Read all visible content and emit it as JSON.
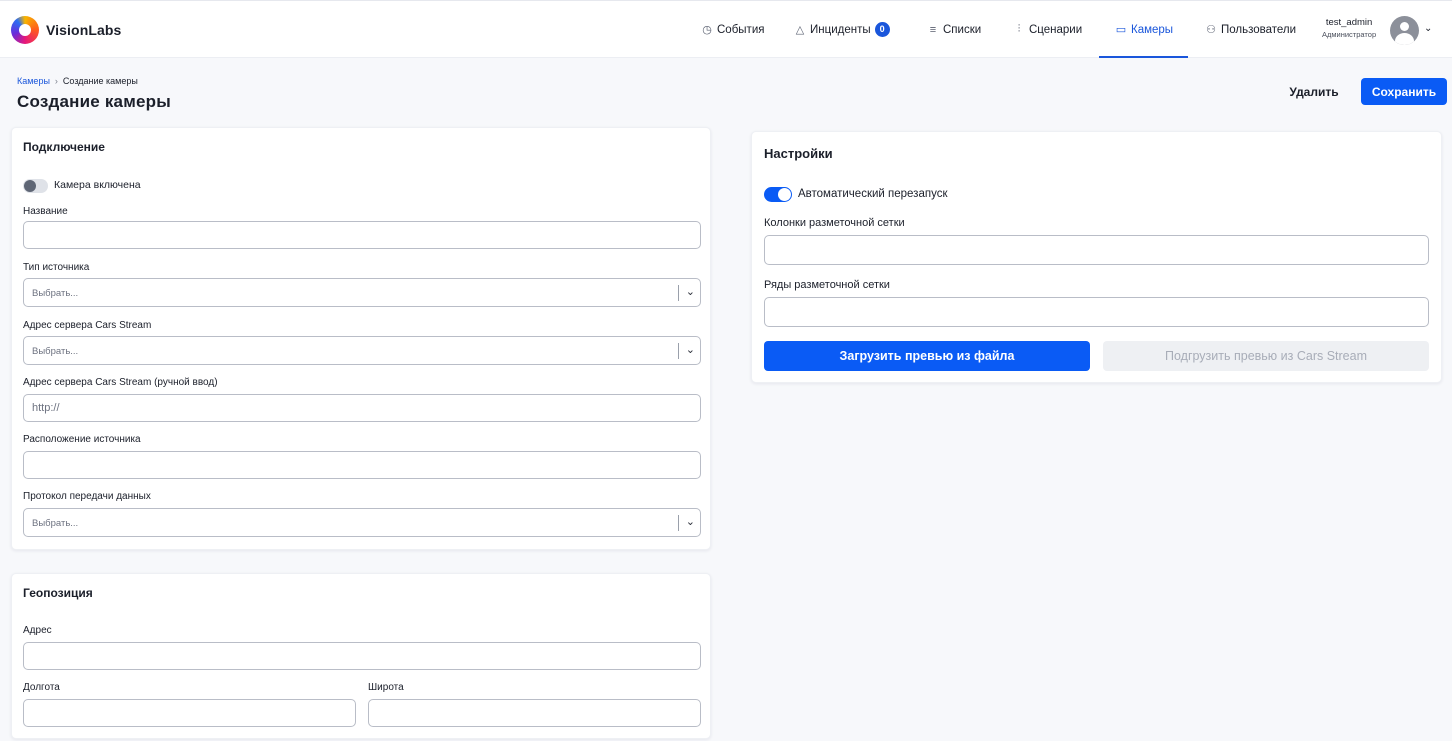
{
  "app": {
    "brand": "VisionLabs"
  },
  "nav": [
    {
      "label": "События",
      "icon": "clock-icon",
      "glyph": "◷"
    },
    {
      "label": "Инциденты",
      "icon": "warning-icon",
      "glyph": "△",
      "badge": "0"
    },
    {
      "label": "Списки",
      "icon": "list-icon",
      "glyph": "≡"
    },
    {
      "label": "Сценарии",
      "icon": "sliders-icon",
      "glyph": "⫶"
    },
    {
      "label": "Камеры",
      "icon": "camera-icon",
      "glyph": "▭",
      "active": true
    },
    {
      "label": "Пользователи",
      "icon": "users-icon",
      "glyph": "⚇"
    }
  ],
  "user": {
    "name": "test_admin",
    "role": "Администратор"
  },
  "breadcrumb": {
    "parent": "Камеры",
    "current": "Создание камеры"
  },
  "page": {
    "title": "Создание камеры"
  },
  "actions": {
    "delete": "Удалить",
    "save": "Сохранить"
  },
  "connection": {
    "title": "Подключение",
    "enabled_label": "Камера включена",
    "enabled": false,
    "name_label": "Название",
    "source_type_label": "Тип источника",
    "source_type_placeholder": "Выбрать...",
    "server_label": "Адрес сервера Cars Stream",
    "server_placeholder": "Выбрать...",
    "server_manual_label": "Адрес сервера Cars Stream (ручной ввод)",
    "server_manual_placeholder": "http://",
    "location_label": "Расположение источника",
    "protocol_label": "Протокол передачи данных",
    "protocol_placeholder": "Выбрать..."
  },
  "geo": {
    "title": "Геопозиция",
    "address_label": "Адрес",
    "longitude_label": "Долгота",
    "latitude_label": "Широта"
  },
  "settings": {
    "title": "Настройки",
    "auto_restart_label": "Автоматический перезапуск",
    "auto_restart": true,
    "grid_cols_label": "Колонки разметочной сетки",
    "grid_rows_label": "Ряды разметочной сетки",
    "upload_preview": "Загрузить превью из файла",
    "load_preview": "Подгрузить превью из Cars Stream"
  },
  "colors": {
    "accent": "#0a5bf5",
    "link": "#1a56db",
    "disabled_bg": "#eef0f3"
  }
}
